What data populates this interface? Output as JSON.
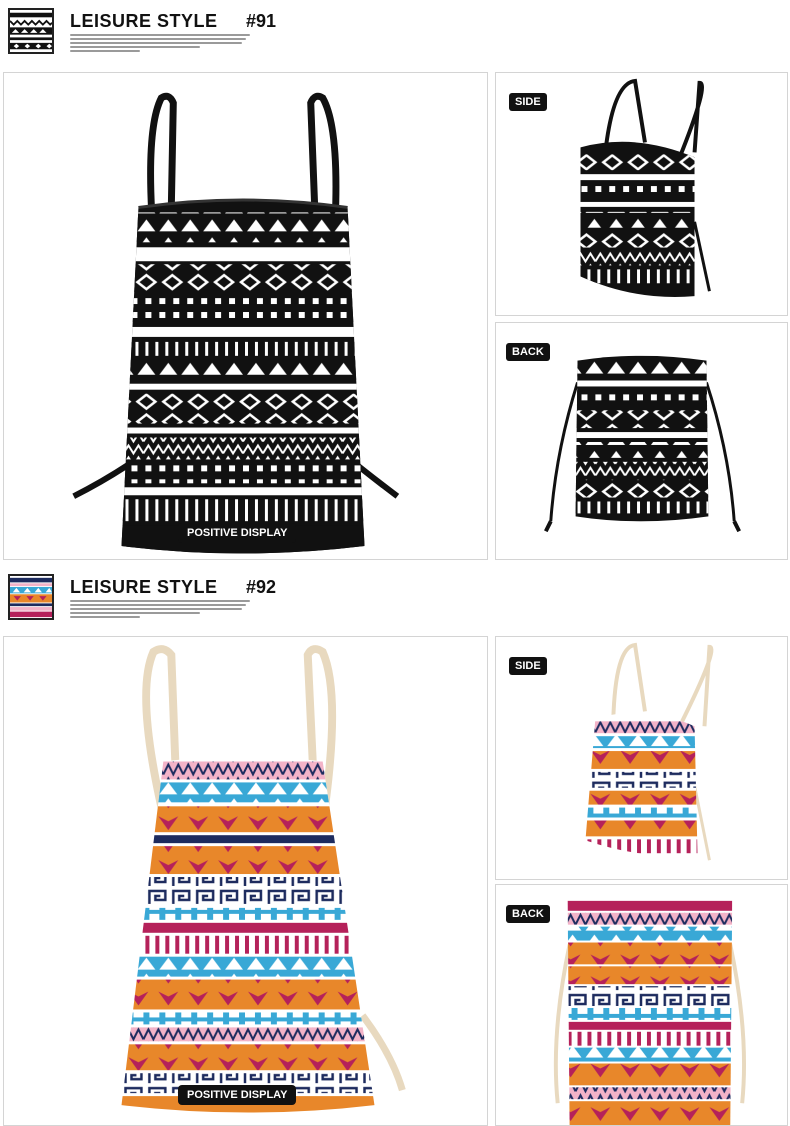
{
  "sections": [
    {
      "title": "LEISURE STYLE",
      "number": "#91",
      "front_label": "POSITIVE DISPLAY",
      "side_label": "SIDE",
      "back_label": "BACK",
      "colors": {
        "fabric": "#111111",
        "pattern": "#ffffff",
        "cord": "#111111"
      }
    },
    {
      "title": "LEISURE STYLE",
      "number": "#92",
      "front_label": "POSITIVE DISPLAY",
      "side_label": "SIDE",
      "back_label": "BACK",
      "colors": {
        "cord": "#e8d9bf",
        "orange": "#e8872a",
        "blue": "#39a8d6",
        "magenta": "#b5215a",
        "pink": "#f3b3c8",
        "navy": "#1d2b5e",
        "white": "#ffffff"
      }
    }
  ]
}
